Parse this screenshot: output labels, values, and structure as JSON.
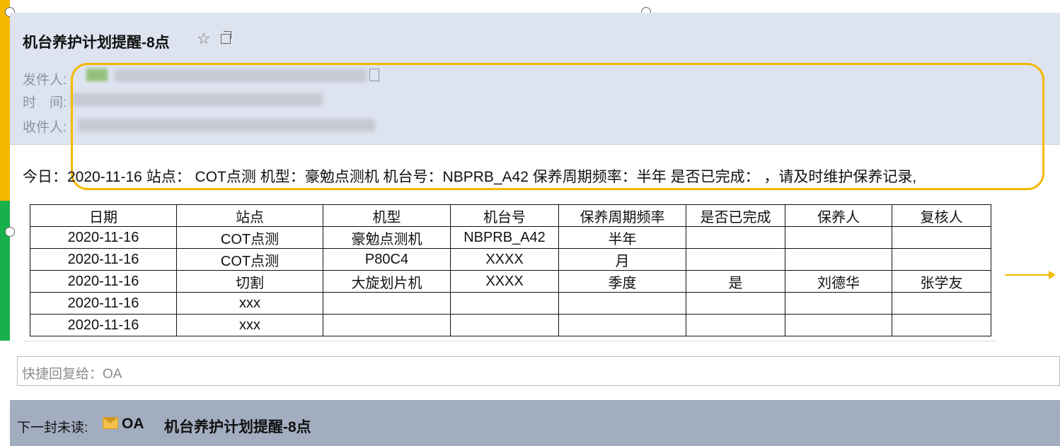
{
  "email": {
    "subject": "机台养护计划提醒-8点",
    "from_label": "发件人:",
    "time_label": "时　间:",
    "to_label": "收件人:",
    "body_line": "今日：2020-11-16 站点： COT点测 机型：豪勉点测机 机台号：NBPRB_A42 保养周期频率：半年 是否已完成： ，请及时维护保养记录,"
  },
  "table": {
    "headers": [
      "日期",
      "站点",
      "机型",
      "机台号",
      "保养周期频率",
      "是否已完成",
      "保养人",
      "复核人"
    ],
    "rows": [
      [
        "2020-11-16",
        "COT点测",
        "豪勉点测机",
        "NBPRB_A42",
        "半年",
        "",
        "",
        ""
      ],
      [
        "2020-11-16",
        "COT点测",
        "P80C4",
        "XXXX",
        "月",
        "",
        "",
        ""
      ],
      [
        "2020-11-16",
        "切割",
        "大旋划片机",
        "XXXX",
        "季度",
        "是",
        "刘德华",
        "张学友"
      ],
      [
        "2020-11-16",
        "xxx",
        "",
        "",
        "",
        "",
        "",
        ""
      ],
      [
        "2020-11-16",
        "xxx",
        "",
        "",
        "",
        "",
        "",
        ""
      ]
    ]
  },
  "quick_reply": {
    "placeholder": "快捷回复给：OA"
  },
  "footer": {
    "next_unread_label": "下一封未读:",
    "sender": "OA",
    "subject": "机台养护计划提醒-8点"
  },
  "icons": {
    "star": "star-icon",
    "popout": "popout-window-icon",
    "mail": "envelope-icon"
  },
  "colors": {
    "highlight": "#f5b800",
    "header_bg": "#dde3ef",
    "footer_bg": "#a3adc0",
    "left_bar_top": "#f5b800",
    "left_bar_bottom": "#17b04c"
  }
}
